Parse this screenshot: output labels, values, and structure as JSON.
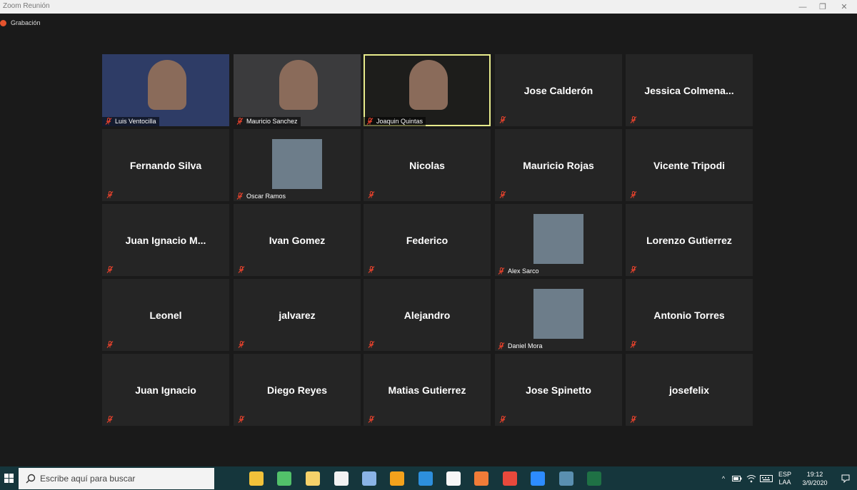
{
  "window": {
    "title": "Zoom Reunión",
    "minimize": "—",
    "maximize": "❐",
    "close": "✕"
  },
  "recording": {
    "label": "Grabación",
    "color": "#e5532d"
  },
  "participants": [
    {
      "name": "Luis Ventocilla",
      "video": true,
      "bg": "#2e3c66"
    },
    {
      "name": "Mauricio Sanchez",
      "video": true,
      "bg": "#3b3b3d"
    },
    {
      "name": "Joaquin Quintas",
      "video": true,
      "bg": "#1d1d1b",
      "active": true
    },
    {
      "name": "Jose Calderón"
    },
    {
      "name": "Jessica  Colmena..."
    },
    {
      "name": "Fernando Silva"
    },
    {
      "name": "Oscar Ramos",
      "avatar": true
    },
    {
      "name": "Nicolas"
    },
    {
      "name": "Mauricio Rojas"
    },
    {
      "name": "Vicente Tripodi"
    },
    {
      "name": "Juan  Ignacio  M..."
    },
    {
      "name": "Ivan Gomez"
    },
    {
      "name": "Federico"
    },
    {
      "name": "Alex Sarco",
      "avatar": true
    },
    {
      "name": "Lorenzo Gutierrez"
    },
    {
      "name": "Leonel"
    },
    {
      "name": "jalvarez"
    },
    {
      "name": "Alejandro"
    },
    {
      "name": "Daniel Mora",
      "avatar": true
    },
    {
      "name": "Antonio Torres"
    },
    {
      "name": "Juan Ignacio"
    },
    {
      "name": "Diego Reyes"
    },
    {
      "name": "Matias Gutierrez"
    },
    {
      "name": "Jose Spinetto"
    },
    {
      "name": "josefelix"
    }
  ],
  "taskbar": {
    "search_placeholder": "Escribe aquí para buscar",
    "apps": [
      {
        "name": "task-view-icon",
        "color": "#15363c"
      },
      {
        "name": "file-explorer-icon",
        "color": "#f2c23a"
      },
      {
        "name": "green-app-icon",
        "color": "#52c16a"
      },
      {
        "name": "notes-app-icon",
        "color": "#f5d26a"
      },
      {
        "name": "contact-app-icon",
        "color": "#f2f2f2"
      },
      {
        "name": "3d-app-icon",
        "color": "#8ab4e6"
      },
      {
        "name": "sublime-text-icon",
        "color": "#f3a21c"
      },
      {
        "name": "vscode-icon",
        "color": "#2d8fdc"
      },
      {
        "name": "slack-icon",
        "color": "#f7f7f7"
      },
      {
        "name": "postman-icon",
        "color": "#f07c38"
      },
      {
        "name": "chrome-icon",
        "color": "#e8493c"
      },
      {
        "name": "zoom-icon",
        "color": "#2d8cff"
      },
      {
        "name": "vpn-app-icon",
        "color": "#5a8fb0"
      },
      {
        "name": "excel-icon",
        "color": "#1f7145"
      }
    ],
    "language_top": "ESP",
    "language_bottom": "LAA",
    "time": "19:12",
    "date": "3/9/2020"
  }
}
